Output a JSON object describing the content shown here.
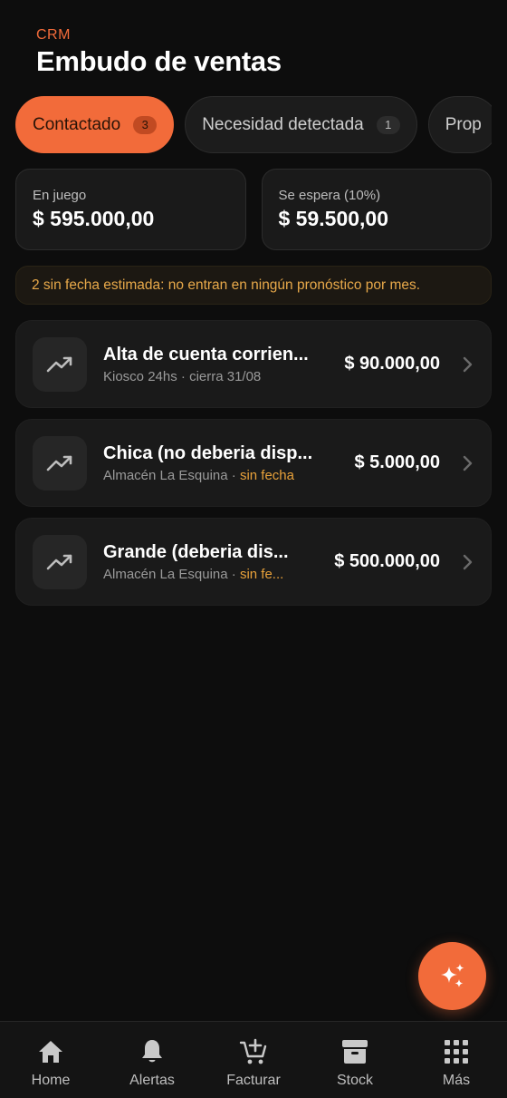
{
  "header": {
    "eyebrow": "CRM",
    "title": "Embudo de ventas"
  },
  "tabs": [
    {
      "label": "Contactado",
      "count": "3",
      "active": true
    },
    {
      "label": "Necesidad detectada",
      "count": "1",
      "active": false
    },
    {
      "label": "Prop",
      "count": "",
      "active": false
    }
  ],
  "stats": {
    "in_play": {
      "label": "En juego",
      "value": "$ 595.000,00"
    },
    "expected": {
      "label": "Se espera (10%)",
      "value": "$ 59.500,00"
    }
  },
  "notice": "2 sin fecha estimada: no entran en ningún pronóstico por mes.",
  "deals": [
    {
      "name": "Alta de cuenta corrien...",
      "client": "Kiosco 24hs",
      "separator": " · ",
      "date": "cierra 31/08",
      "date_highlight": false,
      "amount": "$ 90.000,00",
      "icon": "trending-up-icon"
    },
    {
      "name": "Chica (no deberia disp...",
      "client": "Almacén La Esquina",
      "separator": " · ",
      "date": "sin fecha",
      "date_highlight": true,
      "amount": "$ 5.000,00",
      "icon": "trending-up-icon"
    },
    {
      "name": "Grande (deberia dis...",
      "client": "Almacén La Esquina",
      "separator": " · ",
      "date": "sin fe...",
      "date_highlight": true,
      "amount": "$ 500.000,00",
      "icon": "trending-up-icon"
    }
  ],
  "fab": {
    "icon": "sparkles-icon"
  },
  "bottom_nav": [
    {
      "label": "Home",
      "icon": "home-icon"
    },
    {
      "label": "Alertas",
      "icon": "bell-icon"
    },
    {
      "label": "Facturar",
      "icon": "cart-plus-icon"
    },
    {
      "label": "Stock",
      "icon": "archive-box-icon"
    },
    {
      "label": "Más",
      "icon": "grid-icon"
    }
  ],
  "colors": {
    "accent": "#f26b3a",
    "background": "#0d0d0d",
    "card": "#1a1a1a",
    "warning_text": "#e8a94a"
  }
}
